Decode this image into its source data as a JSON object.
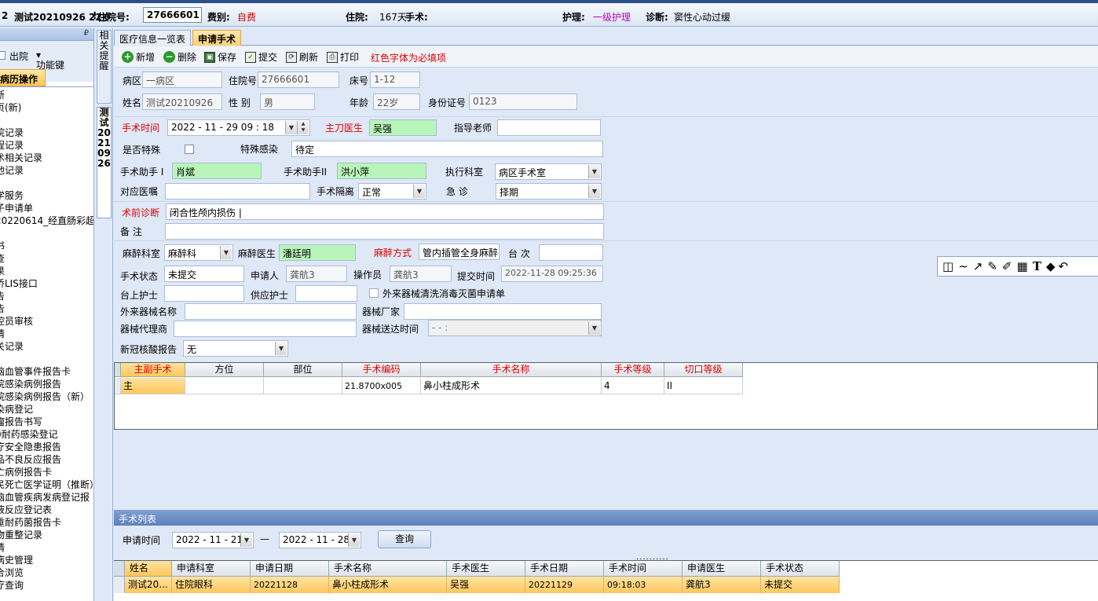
{
  "patient_bar": {
    "index": "2",
    "name_age": "测试20210926 22岁",
    "inpatient_label": "住院号:",
    "inpatient_no": "27666601",
    "fee_label": "费别:",
    "fee_value": "自费",
    "stay_label": "住院:",
    "stay_value": "167天",
    "surgery_label": "手术:",
    "nursing_label": "护理:",
    "nursing_value": "一级护理",
    "diag_label": "诊断:",
    "diag_value": "窦性心动过缓"
  },
  "left_panel": {
    "toolbar_discharge": "出院",
    "toolbar_function": "功能键",
    "tab_title": "病历操作",
    "items": [
      "断",
      "页(新)",
      "",
      "院记录",
      "程记录",
      "术相关记录",
      "他记录",
      "",
      "学服务",
      "子申请单",
      "20220614_经直肠彩超",
      "",
      "书",
      "查",
      "果",
      "侨LIS接口",
      "告",
      "告",
      "控员审核",
      "请",
      "关记录",
      "",
      "脑血管事件报告卡",
      "院感染病例报告",
      "院感染病例报告（新）",
      "染病登记",
      "瘤报告书写",
      "0耐药感染登记",
      "疗安全隐患报告",
      "品不良反应报告",
      "亡病例报告卡",
      "民死亡医学证明（推断）",
      "脑血管疾病发病登记报",
      "液反应登记表",
      "重耐药菌报告卡",
      "物重整记录",
      "请",
      "病史管理",
      "合浏览",
      "疗查询"
    ]
  },
  "vtabs": {
    "tab1": "相关提醒",
    "tab2": "测试20210926"
  },
  "tabs": {
    "list": "医疗信息一览表",
    "apply": "申请手术"
  },
  "toolbar": {
    "add": "新增",
    "delete": "删除",
    "save": "保存",
    "submit": "提交",
    "refresh": "刷新",
    "print": "打印",
    "hint": "红色字体为必填项"
  },
  "form": {
    "ward_label": "病区",
    "ward": "一病区",
    "inno_label": "住院号",
    "inno": "27666601",
    "bed_label": "床号",
    "bed": "1-12",
    "name_label": "姓名",
    "name": "测试20210926",
    "sex_label": "性  别",
    "sex": "男",
    "age_label": "年龄",
    "age": "22岁",
    "id_label": "身份证号",
    "id": "0123",
    "optime_label": "手术时间",
    "optime": "2022 - 11 - 29    09 : 18",
    "surgeon_label": "主刀医生",
    "surgeon": "吴强",
    "mentor_label": "指导老师",
    "mentor": "",
    "special_label": "是否特殊",
    "infect_label": "特殊感染",
    "infect": "待定",
    "asst1_label": "手术助手 I",
    "asst1": "肖斌",
    "asst2_label": "手术助手II",
    "asst2": "洪小萍",
    "dept_label": "执行科室",
    "dept": "病区手术室",
    "order_label": "对应医嘱",
    "order": "",
    "isolation_label": "手术隔离",
    "isolation": "正常",
    "urgent_label": "急    诊",
    "urgent": "择期",
    "prediag_label": "术前诊断",
    "prediag": "闭合性颅内损伤 |",
    "remark_label": "备    注",
    "remark": "",
    "anes_dept_label": "麻醉科室",
    "anes_dept": "麻醉科",
    "anes_doc_label": "麻醉医生",
    "anes_doc": "潘廷明",
    "anes_method_label": "麻醉方式",
    "anes_method": "管内插管全身麻醉",
    "table_no_label": "台  次",
    "table_no": "",
    "status_label": "手术状态",
    "status": "未提交",
    "applicant_label": "申请人",
    "applicant": "龚航3",
    "operator_label": "操作员",
    "operator": "龚航3",
    "submit_time_label": "提交时间",
    "submit_time": "2022-11-28 09:25:36",
    "nurse1_label": "台上护士",
    "nurse1": "",
    "nurse2_label": "供应护士",
    "nurse2": "",
    "external_chk_label": "外来器械清洗消毒灭菌申请单",
    "ext_name_label": "外来器械名称",
    "ext_name": "",
    "ext_maker_label": "器械厂家",
    "ext_maker": "",
    "ext_agent_label": "器械代理商",
    "ext_agent": "",
    "ext_time_label": "器械送达时间",
    "ext_time": "  -    -         :",
    "covid_label": "新冠核酸报告",
    "covid": "无"
  },
  "op_grid": {
    "headers": [
      "主副手术",
      "方位",
      "部位",
      "手术编码",
      "手术名称",
      "手术等级",
      "切口等级"
    ],
    "row": [
      "主",
      "",
      "",
      "21.8700x005",
      "鼻小柱成形术",
      "4",
      "II"
    ]
  },
  "op_list": {
    "section_title": "手术列表",
    "query_label": "申请时间",
    "date_from": "2022 - 11 - 21",
    "dash": "—",
    "date_to": "2022 - 11 - 28",
    "query_btn": "查询",
    "headers": [
      "姓名",
      "申请科室",
      "申请日期",
      "手术名称",
      "手术医生",
      "手术日期",
      "手术时间",
      "申请医生",
      "手术状态"
    ],
    "row": [
      "测试20...",
      "住院眼科",
      "20221128",
      "鼻小柱成形术",
      "吴强",
      "20221129",
      "09:18:03",
      "龚航3",
      "未提交"
    ]
  },
  "colors": {
    "required": "#e00000",
    "highlight_green": "#b8f5b8",
    "selected_row": "#ffc85a"
  }
}
